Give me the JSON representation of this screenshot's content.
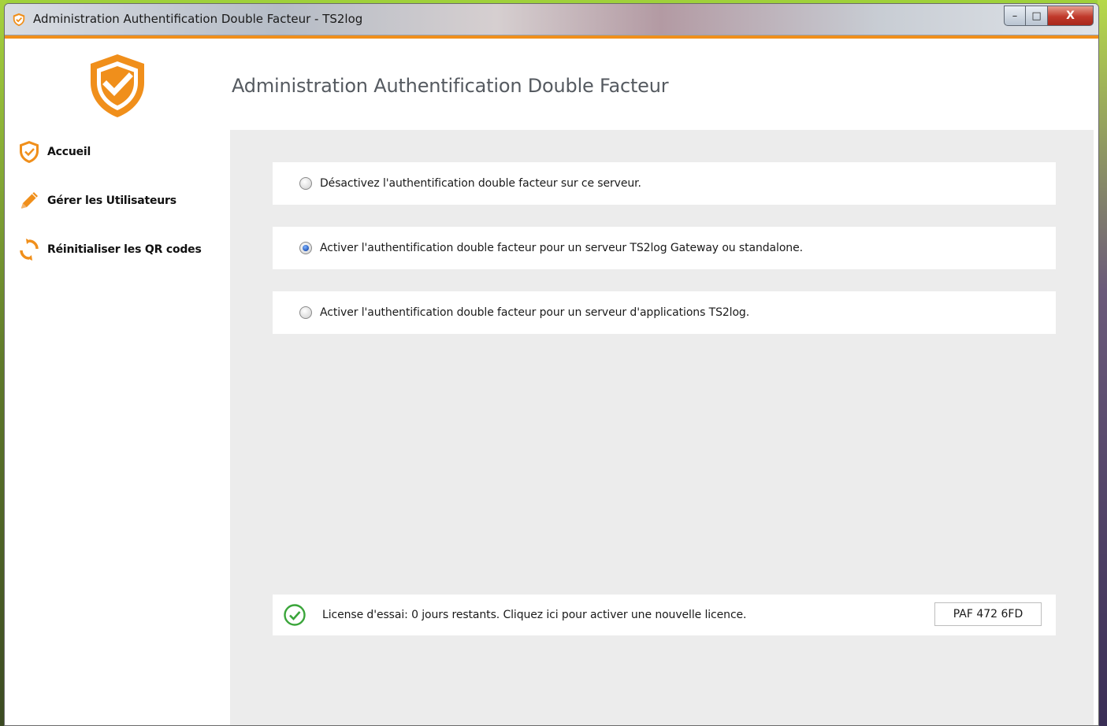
{
  "window": {
    "title": "Administration Authentification Double Facteur - TS2log",
    "controls": {
      "minimize": "–",
      "maximize": "□",
      "close": "X"
    }
  },
  "colors": {
    "accent": "#f08f1b",
    "desktop": "#8cc63f",
    "content_bg": "#ececec",
    "check_green": "#3aa53a"
  },
  "sidebar": {
    "logo_icon": "shield-check-icon",
    "items": [
      {
        "label": "Accueil",
        "icon": "shield-check-icon"
      },
      {
        "label": "Gérer les Utilisateurs",
        "icon": "pencil-icon"
      },
      {
        "label": "Réinitialiser les QR codes",
        "icon": "refresh-icon"
      }
    ]
  },
  "main": {
    "title": "Administration Authentification Double Facteur",
    "options": [
      {
        "label": "Désactivez l'authentification double facteur sur ce serveur.",
        "selected": false
      },
      {
        "label": "Activer l'authentification double facteur pour un serveur TS2log Gateway ou standalone.",
        "selected": true
      },
      {
        "label": "Activer l'authentification double facteur pour un serveur d'applications TS2log.",
        "selected": false
      }
    ],
    "license": {
      "icon": "check-circle-icon",
      "text": "License d'essai: 0 jours restants. Cliquez ici pour activer une nouvelle licence.",
      "code": "PAF 472 6FD"
    }
  }
}
